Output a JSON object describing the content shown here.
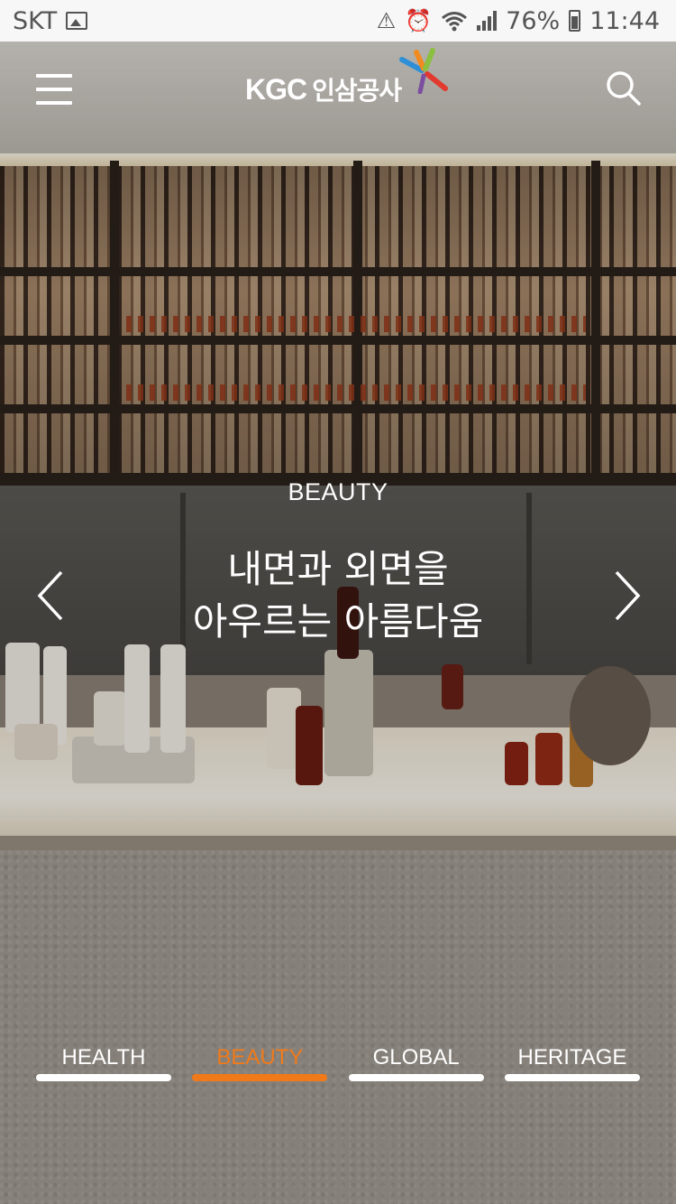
{
  "status_bar": {
    "carrier": "SKT",
    "battery": "76%",
    "time": "11:44"
  },
  "header": {
    "logo_text": "KGC",
    "logo_korean": "인삼공사",
    "menu_icon": "hamburger-menu-icon",
    "search_icon": "search-icon"
  },
  "slide": {
    "category": "BEAUTY",
    "headline_line1": "내면과 외면을",
    "headline_line2": "아우르는 아름다움",
    "prev_icon": "chevron-left-icon",
    "next_icon": "chevron-right-icon"
  },
  "tabs": [
    {
      "label": "HEALTH",
      "active": false
    },
    {
      "label": "BEAUTY",
      "active": true
    },
    {
      "label": "GLOBAL",
      "active": false
    },
    {
      "label": "HERITAGE",
      "active": false
    }
  ],
  "colors": {
    "accent": "#f07a1a",
    "text": "#ffffff"
  }
}
